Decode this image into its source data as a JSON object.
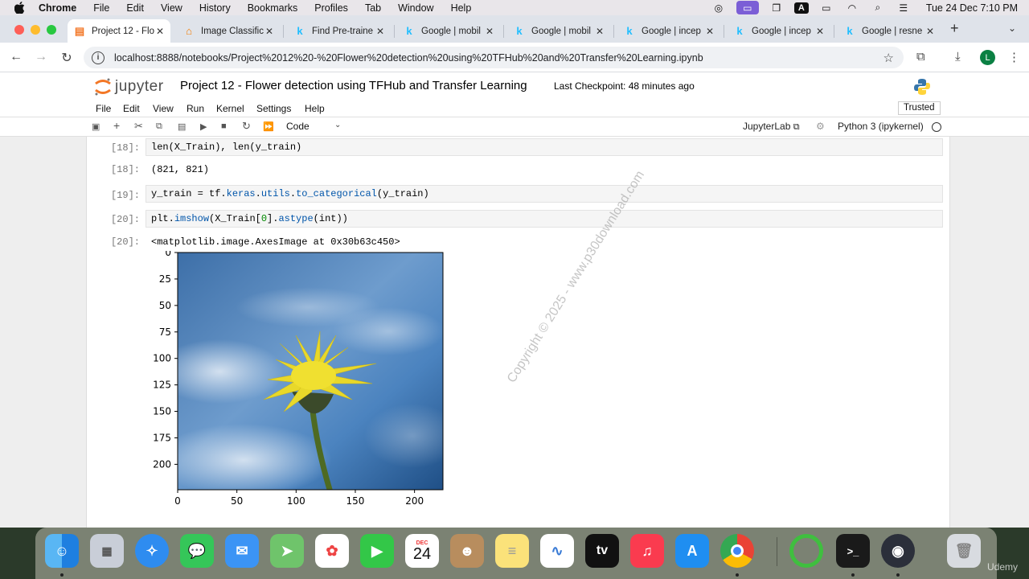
{
  "menubar": {
    "app": "Chrome",
    "items": [
      "File",
      "Edit",
      "View",
      "History",
      "Bookmarks",
      "Profiles",
      "Tab",
      "Window",
      "Help"
    ],
    "clock": "Tue 24 Dec  7:10 PM"
  },
  "tabs": [
    {
      "title": "Project 12 - Flo",
      "favicon": "jupyter-icon",
      "active": true
    },
    {
      "title": "Image Classific",
      "favicon": "tfhub-icon"
    },
    {
      "title": "Find Pre-traine",
      "favicon": "kaggle-icon"
    },
    {
      "title": "Google | mobil",
      "favicon": "kaggle-icon"
    },
    {
      "title": "Google | mobil",
      "favicon": "kaggle-icon"
    },
    {
      "title": "Google | incep",
      "favicon": "kaggle-icon"
    },
    {
      "title": "Google | incep",
      "favicon": "kaggle-icon"
    },
    {
      "title": "Google | resne",
      "favicon": "kaggle-icon"
    }
  ],
  "address": {
    "url": "localhost:8888/notebooks/Project%2012%20-%20Flower%20detection%20using%20TFHub%20and%20Transfer%20Learning.ipynb",
    "profile_initial": "L"
  },
  "jupyter": {
    "logo_text": "jupyter",
    "notebook_title": "Project 12 - Flower detection using TFHub and Transfer Learning",
    "checkpoint": "Last Checkpoint: 48 minutes ago",
    "menu": [
      "File",
      "Edit",
      "View",
      "Run",
      "Kernel",
      "Settings",
      "Help"
    ],
    "trusted": "Trusted",
    "cell_type": "Code",
    "jupyterlab_link": "JupyterLab",
    "kernel": "Python 3 (ipykernel)"
  },
  "cells": [
    {
      "in_prompt": "[18]:",
      "code_parts": [
        "len(X_Train), len(y_train)"
      ],
      "out_prompt": "[18]:",
      "output": "(821, 821)"
    },
    {
      "in_prompt": "[19]:",
      "code_parts": [
        "y_train = tf.",
        "keras",
        ".",
        "utils",
        ".",
        "to_categorical",
        "(y_train)"
      ]
    },
    {
      "in_prompt": "[20]:",
      "code_parts": [
        "plt.",
        "imshow",
        "(X_Train[",
        "0",
        "].",
        "astype",
        "(int))"
      ],
      "out_prompt": "[20]:",
      "output": "<matplotlib.image.AxesImage at 0x30b63c450>"
    }
  ],
  "chart_data": {
    "type": "image",
    "x_ticks": [
      0,
      50,
      100,
      150,
      200
    ],
    "y_ticks": [
      0,
      25,
      50,
      75,
      100,
      125,
      150,
      175,
      200
    ],
    "xlim": [
      0,
      224
    ],
    "ylim": [
      224,
      0
    ],
    "content": "yellow dandelion flower against blue cloudy sky"
  },
  "watermark": "Copyright © 2025 - www.p30download.com",
  "dock": {
    "apps": [
      "Finder",
      "Launchpad",
      "Safari",
      "Messages",
      "Mail",
      "Maps",
      "Photos",
      "FaceTime",
      "Calendar",
      "Contacts",
      "Notes",
      "Freeform",
      "TV",
      "Music",
      "App Store",
      "Chrome",
      "Activity",
      "Terminal",
      "OBS",
      "Trash"
    ],
    "calendar_month": "DEC",
    "calendar_day": "24",
    "tv_label": "tv"
  },
  "brand_corner": "Udemy"
}
